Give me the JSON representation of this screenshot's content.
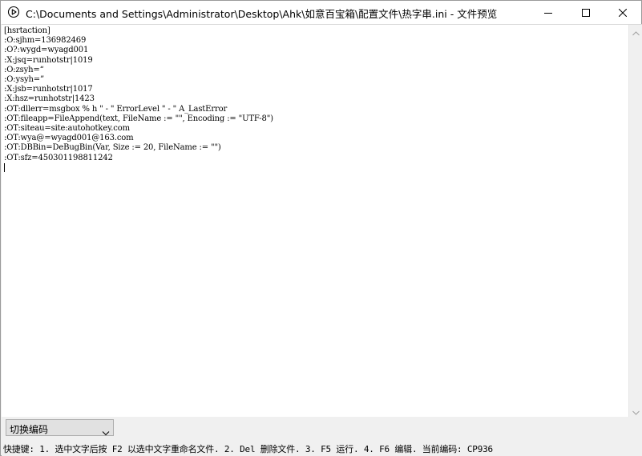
{
  "window": {
    "title": "C:\\Documents and Settings\\Administrator\\Desktop\\Ahk\\如意百宝箱\\配置文件\\热字串.ini - 文件预览",
    "app_icon": "play-circle-icon"
  },
  "titlebar_buttons": {
    "minimize_icon": "minimize-icon",
    "maximize_icon": "maximize-icon",
    "close_icon": "close-icon"
  },
  "editor": {
    "lines": [
      "[hsrtaction]",
      ":O:sjhm=136982469",
      ":O?:wygd=wyagd001",
      ":X:jsq=runhotstr|1019",
      ":O:zsyh=“",
      ":O:ysyh=”",
      ":X:jsb=runhotstr|1017",
      ":X:hsz=runhotstr|1423",
      ":OT:dllerr=msgbox % h \" - \" ErrorLevel \" - \" A_LastError",
      ":OT:fileapp=FileAppend(text, FileName := \"\", Encoding := \"UTF-8\")",
      ":OT:siteau=site:autohotkey.com",
      ":OT:wya@=wyagd001@163.com",
      ":OT:DBBin=DeBugBin(Var, Size := 20, FileName := \"\")",
      ":OT:sfz=450301198811242"
    ]
  },
  "encoding_combo": {
    "label": "切换编码",
    "arrow_icon": "chevron-down-icon"
  },
  "status_bar": {
    "text": "快捷键: 1. 选中文字后按 F2 以选中文字重命名文件. 2. Del 删除文件. 3. F5 运行. 4. F6 编辑. 当前编码: CP936"
  }
}
